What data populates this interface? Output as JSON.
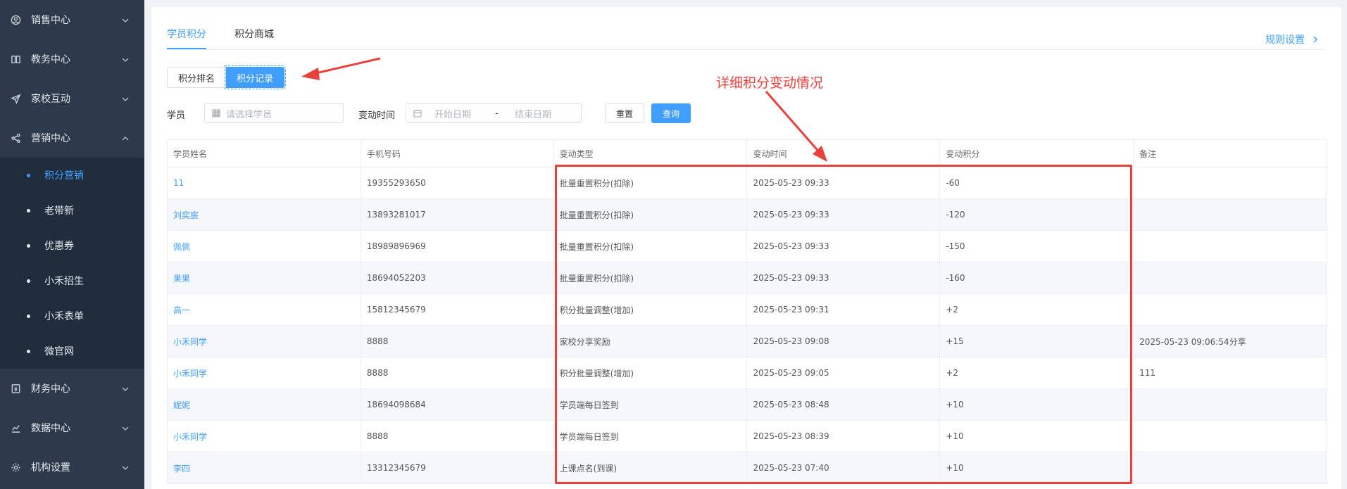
{
  "sidebar": {
    "items": [
      {
        "label": "销售中心",
        "icon": "user-circle-icon",
        "expanded": false
      },
      {
        "label": "教务中心",
        "icon": "book-icon",
        "expanded": false
      },
      {
        "label": "家校互动",
        "icon": "send-icon",
        "expanded": false
      },
      {
        "label": "营销中心",
        "icon": "share-icon",
        "expanded": true
      },
      {
        "label": "财务中心",
        "icon": "finance-icon",
        "expanded": false
      },
      {
        "label": "数据中心",
        "icon": "chart-icon",
        "expanded": false
      },
      {
        "label": "机构设置",
        "icon": "gear-icon",
        "expanded": false
      }
    ],
    "submenu": [
      {
        "label": "积分营销",
        "active": true
      },
      {
        "label": "老带新",
        "active": false
      },
      {
        "label": "优惠券",
        "active": false
      },
      {
        "label": "小禾招生",
        "active": false
      },
      {
        "label": "小禾表单",
        "active": false
      },
      {
        "label": "微官网",
        "active": false
      }
    ]
  },
  "tabs": [
    {
      "label": "学员积分",
      "active": true
    },
    {
      "label": "积分商城",
      "active": false
    }
  ],
  "rule_link": "规则设置",
  "segments": [
    {
      "label": "积分排名",
      "active": false
    },
    {
      "label": "积分记录",
      "active": true
    }
  ],
  "filters": {
    "student_label": "学员",
    "student_placeholder": "请选择学员",
    "time_label": "变动时间",
    "start_placeholder": "开始日期",
    "separator": "-",
    "end_placeholder": "结束日期",
    "reset": "重置",
    "query": "查询"
  },
  "table": {
    "headers": [
      "学员姓名",
      "手机号码",
      "变动类型",
      "变动时间",
      "变动积分",
      "备注"
    ],
    "rows": [
      [
        "11",
        "19355293650",
        "批量重置积分(扣除)",
        "2025-05-23 09:33",
        "-60",
        ""
      ],
      [
        "刘奕宸",
        "13893281017",
        "批量重置积分(扣除)",
        "2025-05-23 09:33",
        "-120",
        ""
      ],
      [
        "佩佩",
        "18989896969",
        "批量重置积分(扣除)",
        "2025-05-23 09:33",
        "-150",
        ""
      ],
      [
        "果果",
        "18694052203",
        "批量重置积分(扣除)",
        "2025-05-23 09:33",
        "-160",
        ""
      ],
      [
        "高一",
        "15812345679",
        "积分批量调整(增加)",
        "2025-05-23 09:31",
        "+2",
        ""
      ],
      [
        "小禾同学",
        "8888",
        "家校分享奖励",
        "2025-05-23 09:08",
        "+15",
        "2025-05-23 09:06:54分享"
      ],
      [
        "小禾同学",
        "8888",
        "积分批量调整(增加)",
        "2025-05-23 09:05",
        "+2",
        "111"
      ],
      [
        "妮妮",
        "18694098684",
        "学员端每日签到",
        "2025-05-23 08:48",
        "+10",
        ""
      ],
      [
        "小禾同学",
        "8888",
        "学员端每日签到",
        "2025-05-23 08:39",
        "+10",
        ""
      ],
      [
        "李四",
        "13312345679",
        "上课点名(到课)",
        "2025-05-23 07:40",
        "+10",
        ""
      ]
    ]
  },
  "annotation": {
    "text": "详细积分变动情况",
    "color": "#e8403b"
  },
  "colors": {
    "accent": "#409eff",
    "sidebar_bg": "#2d3a4b",
    "submenu_bg": "#1f2d3d"
  }
}
